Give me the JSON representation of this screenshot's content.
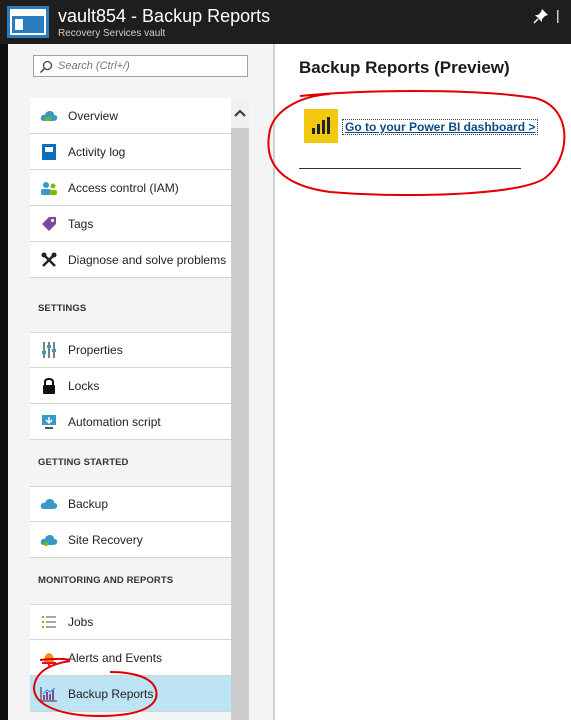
{
  "header": {
    "title": "vault854 - Backup Reports",
    "subtitle": "Recovery Services vault",
    "icons": [
      "vault-icon",
      "pin-icon",
      "close-icon"
    ]
  },
  "search": {
    "placeholder": "Search (Ctrl+/)"
  },
  "sidebar": {
    "items": [
      {
        "label": "Overview",
        "icon": "cloud-icon"
      },
      {
        "label": "Activity log",
        "icon": "activity-log-icon"
      },
      {
        "label": "Access control (IAM)",
        "icon": "people-icon"
      },
      {
        "label": "Tags",
        "icon": "tag-icon"
      },
      {
        "label": "Diagnose and solve problems",
        "icon": "wrench-icon"
      }
    ],
    "settings": {
      "heading": "SETTINGS",
      "items": [
        {
          "label": "Properties",
          "icon": "sliders-icon"
        },
        {
          "label": "Locks",
          "icon": "lock-icon"
        },
        {
          "label": "Automation script",
          "icon": "monitor-download-icon"
        }
      ]
    },
    "getting_started": {
      "heading": "GETTING STARTED",
      "items": [
        {
          "label": "Backup",
          "icon": "cloud-icon"
        },
        {
          "label": "Site Recovery",
          "icon": "cloud-icon"
        }
      ]
    },
    "monitoring": {
      "heading": "MONITORING AND REPORTS",
      "items": [
        {
          "label": "Jobs",
          "icon": "list-icon"
        },
        {
          "label": "Alerts and Events",
          "icon": "bell-icon"
        },
        {
          "label": "Backup Reports",
          "icon": "chart-icon",
          "active": true
        }
      ]
    }
  },
  "main": {
    "title": "Backup Reports (Preview)",
    "link_label": "Go to your Power BI dashboard >"
  },
  "colors": {
    "header_bg": "#1e1e1e",
    "active_item_bg": "#bde4f3",
    "powerbi_yellow": "#f2c811",
    "link": "#0b4c86",
    "annotation_red": "#e00000"
  }
}
